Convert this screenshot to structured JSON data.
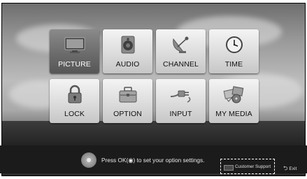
{
  "menu": {
    "items": [
      {
        "label": "PICTURE",
        "icon": "tv-icon",
        "selected": true
      },
      {
        "label": "AUDIO",
        "icon": "speaker-icon",
        "selected": false
      },
      {
        "label": "CHANNEL",
        "icon": "satellite-dish-icon",
        "selected": false
      },
      {
        "label": "TIME",
        "icon": "clock-icon",
        "selected": false
      },
      {
        "label": "LOCK",
        "icon": "padlock-icon",
        "selected": false
      },
      {
        "label": "OPTION",
        "icon": "toolbox-icon",
        "selected": false
      },
      {
        "label": "INPUT",
        "icon": "plug-icon",
        "selected": false
      },
      {
        "label": "MY MEDIA",
        "icon": "media-collage-icon",
        "selected": false
      }
    ]
  },
  "footer": {
    "hint": "Press OK(◉) to set your option settings.",
    "customer_support": "Customer Support",
    "exit": "Exit",
    "exit_icon": "return-arrow-icon"
  },
  "colors": {
    "tile": "#dcdcdc",
    "tile_selected": "#6c6c6c",
    "bar": "#1b1b1b"
  }
}
